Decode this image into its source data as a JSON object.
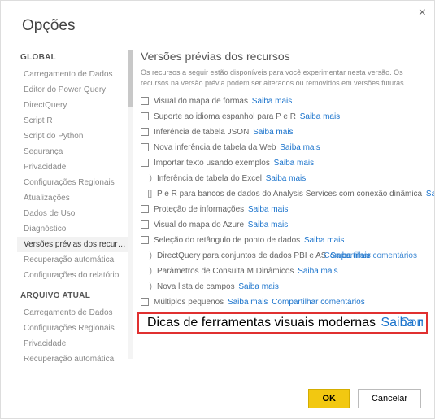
{
  "dialog": {
    "title": "Opções",
    "close": "×"
  },
  "sidebar": {
    "header_global": "GLOBAL",
    "global_items": [
      "Carregamento de Dados",
      "Editor do Power Query",
      "DirectQuery",
      "Script R",
      "Script do Python",
      "Segurança",
      "Privacidade",
      "Configurações Regionais",
      "Atualizações",
      "Dados de Uso",
      "Diagnóstico",
      "Versões prévias dos recursos",
      "Recuperação automática",
      "Configurações do relatório"
    ],
    "header_current": "ARQUIVO ATUAL",
    "current_items": [
      "Carregamento de Dados",
      "Configurações Regionais",
      "Privacidade",
      "Recuperação automática"
    ],
    "active": "Versões prévias dos recursos"
  },
  "content": {
    "title": "Versões prévias dos recursos",
    "desc": "Os recursos a seguir estão disponíveis para você experimentar nesta versão. Os recursos na versão prévia podem ser alterados ou removidos em versões futuras.",
    "learn": "Saiba mais",
    "share": "Compartilhar comentários",
    "items": [
      {
        "label": "Visual do mapa de formas",
        "learn": true
      },
      {
        "label": "Suporte ao idioma espanhol para P e R",
        "learn": true
      },
      {
        "label": "Inferência de tabela JSON",
        "learn": true
      },
      {
        "label": "Nova inferência de tabela da Web",
        "learn": true
      },
      {
        "label": "Importar texto usando exemplos",
        "learn": true
      },
      {
        "indent": ")",
        "label": "Inferência de tabela do Excel",
        "learn": true,
        "nocb": true
      },
      {
        "indent": "[]",
        "label": "P e R para bancos de dados do Analysis Services com conexão dinâmica",
        "learn": true,
        "nocb": true
      },
      {
        "label": "Proteção de informações",
        "learn": true
      },
      {
        "label": "Visual do mapa do Azure",
        "learn": true
      },
      {
        "label": "Seleção do retângulo de ponto de dados",
        "learn": true
      },
      {
        "indent": ")",
        "label": "DirectQuery para conjuntos de dados PBI e AS",
        "learn": true,
        "share": true,
        "nocb": true,
        "overlap": true
      },
      {
        "indent": ")",
        "label": "Parâmetros de Consulta M Dinâmicos",
        "learn": true,
        "nocb": true
      },
      {
        "indent": ")",
        "label": "Nova lista de campos",
        "learn": true,
        "nocb": true
      },
      {
        "label": "Múltiplos pequenos",
        "learn": true,
        "share": true
      },
      {
        "checked": true,
        "highlight": true,
        "label": "Dicas de ferramentas visuais modernas",
        "learn": true,
        "share": true,
        "overlap": true
      }
    ]
  },
  "footer": {
    "ok": "OK",
    "cancel": "Cancelar"
  }
}
